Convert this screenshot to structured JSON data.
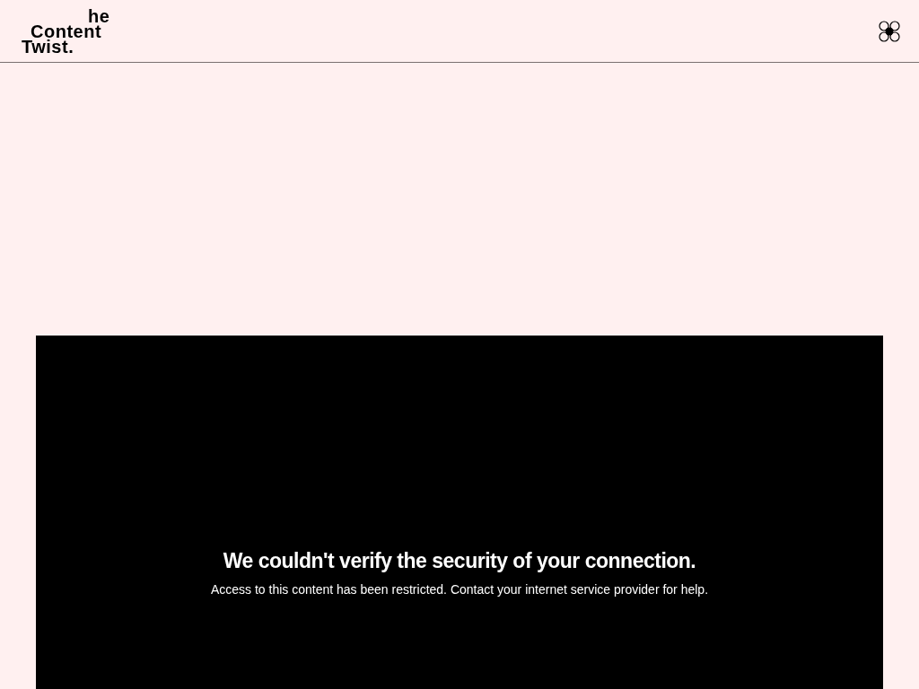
{
  "header": {
    "logo_lines": [
      "he",
      "Content",
      "Twist."
    ]
  },
  "notice": {
    "title": "We couldn't verify the security of your connection.",
    "message": "Access to this content has been restricted. Contact your internet service provider for help."
  }
}
